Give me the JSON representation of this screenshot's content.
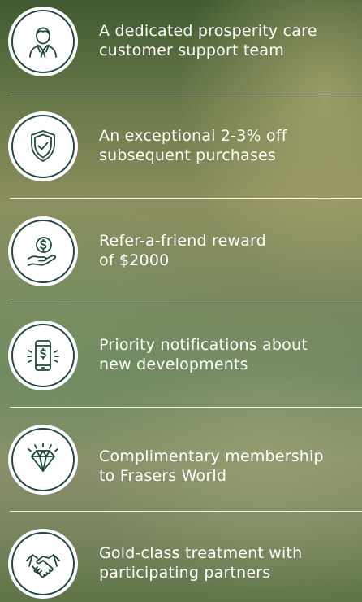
{
  "benefits": [
    {
      "icon": "support-agent-icon",
      "text": "A dedicated prosperity care\ncustomer support team"
    },
    {
      "icon": "shield-check-icon",
      "text": "An exceptional 2-3% off\nsubsequent purchases"
    },
    {
      "icon": "hand-coin-icon",
      "text": "Refer-a-friend reward\nof $2000"
    },
    {
      "icon": "phone-notification-icon",
      "text": "Priority notifications about\nnew developments"
    },
    {
      "icon": "diamond-icon",
      "text": "Complimentary membership\nto Frasers World"
    },
    {
      "icon": "handshake-icon",
      "text": "Gold-class treatment with\nparticipating partners"
    }
  ],
  "colors": {
    "icon_circle": "#ffffff",
    "icon_stroke": "#1d4a3a",
    "text": "#ffffff",
    "divider": "#ffffff"
  }
}
